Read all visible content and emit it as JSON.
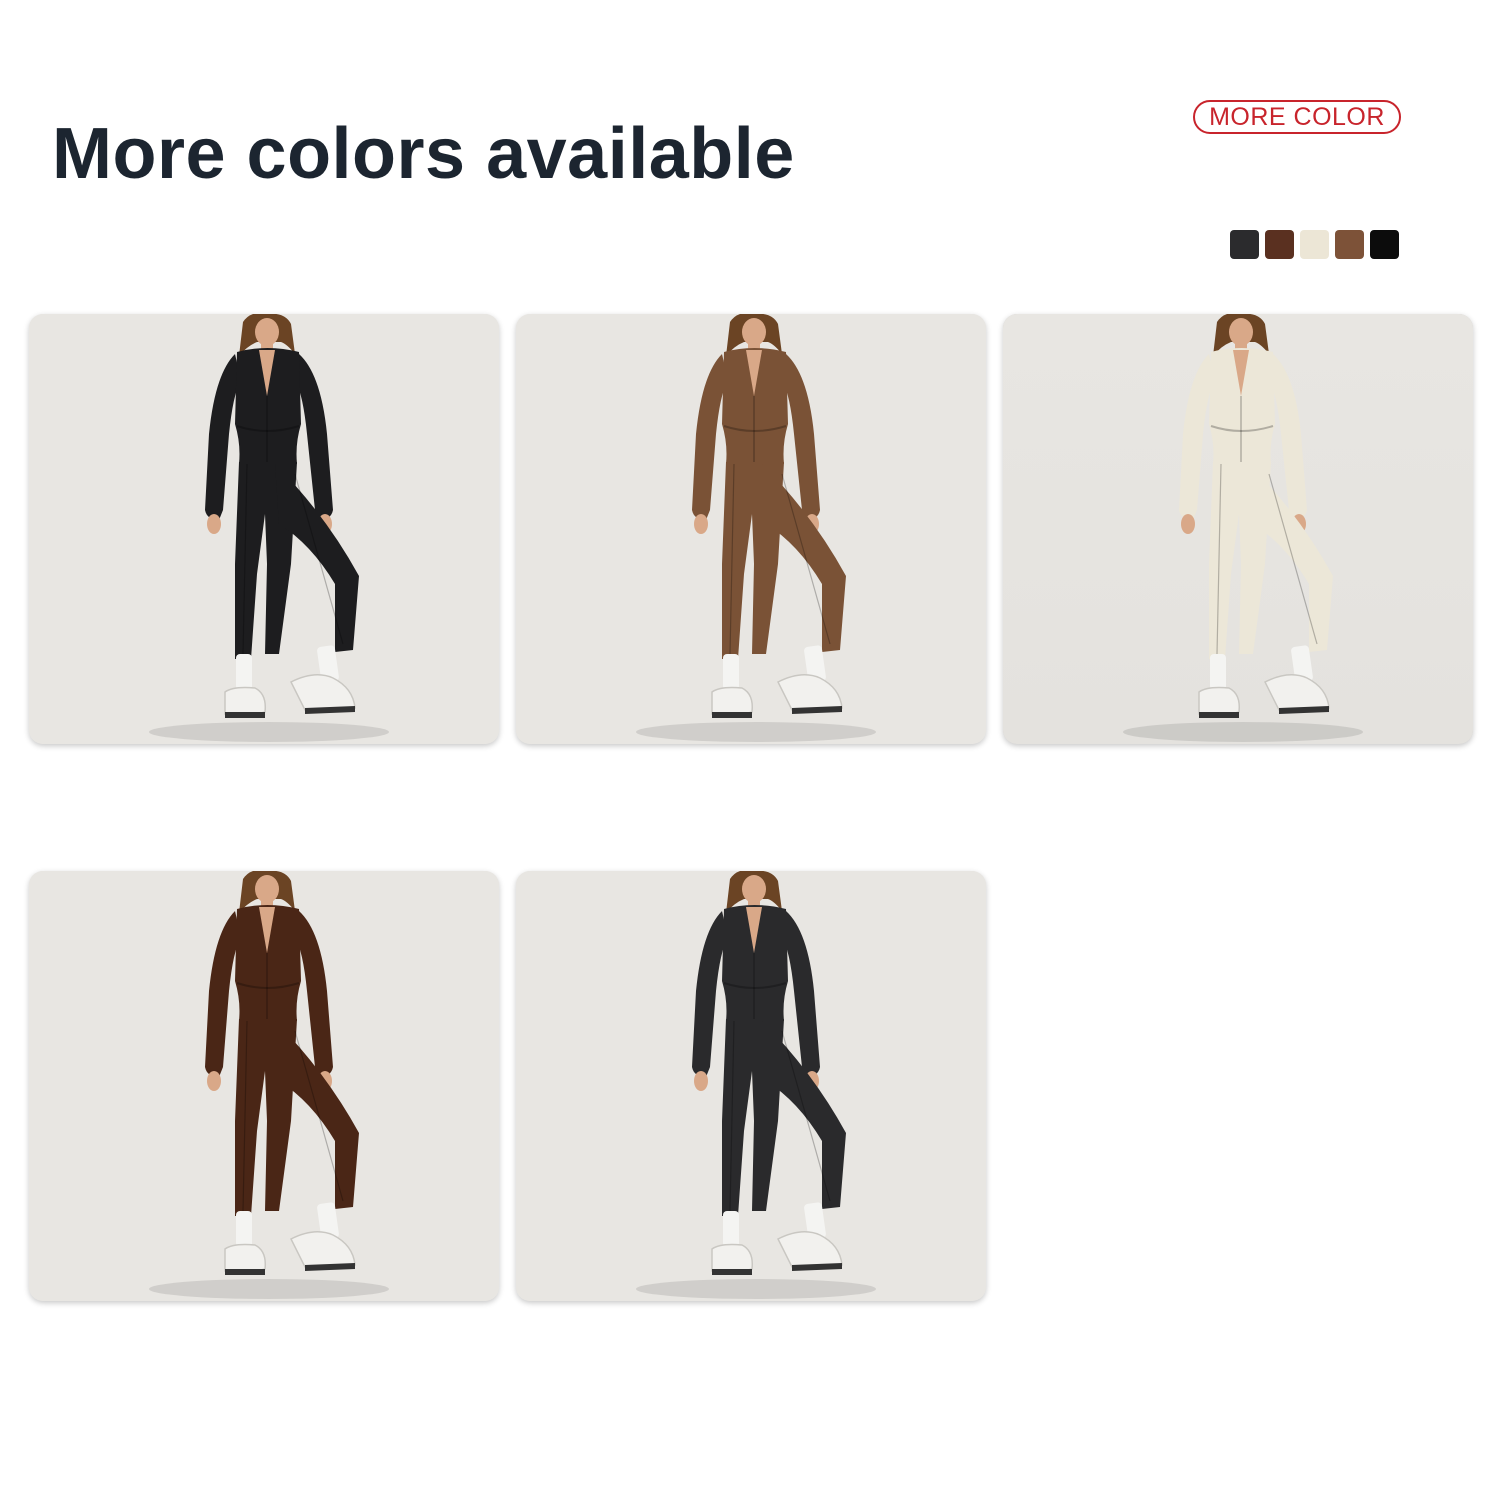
{
  "header": {
    "title": "More colors available",
    "badge_label": "MORE COLOR"
  },
  "swatches": [
    {
      "color": "#2b2b2d"
    },
    {
      "color": "#5a3020"
    },
    {
      "color": "#ece6d6"
    },
    {
      "color": "#7d5238"
    },
    {
      "color": "#0c0c0c"
    }
  ],
  "products": [
    {
      "suit_color": "#1d1d1f",
      "background": "#e8e6e2"
    },
    {
      "suit_color": "#7a5236",
      "background": "#e9e7e3"
    },
    {
      "suit_color": "#ece7d8",
      "background": "#cdcbc8"
    },
    {
      "suit_color": "#4a2616",
      "background": "#e8e6e2"
    },
    {
      "suit_color": "#2a2a2c",
      "background": "#e8e6e2"
    }
  ]
}
